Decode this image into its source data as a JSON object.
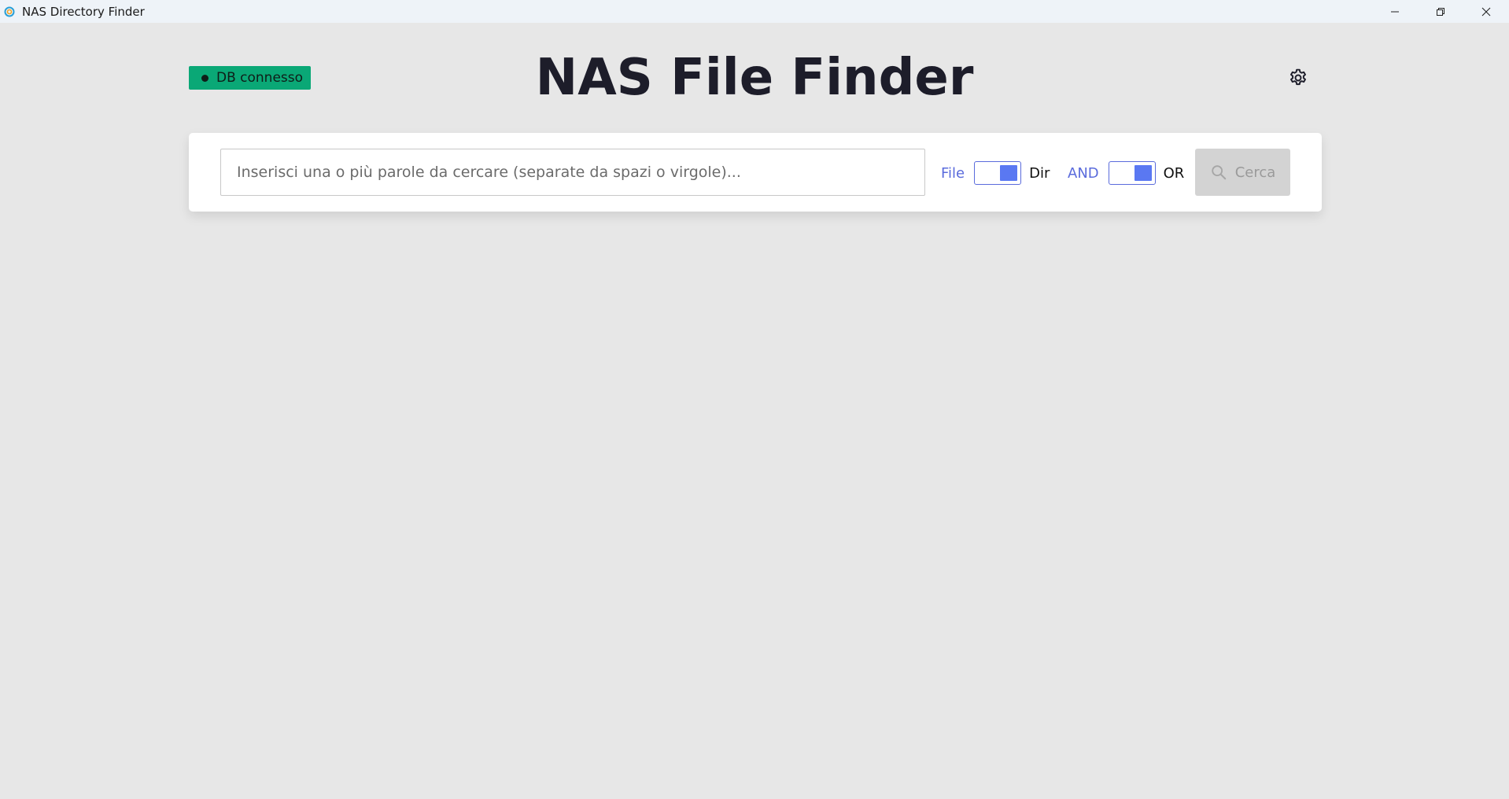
{
  "window": {
    "title": "NAS Directory Finder",
    "app_icon": "nas-app-icon",
    "controls": {
      "minimize": "minimize-icon",
      "restore": "restore-icon",
      "close": "close-icon"
    }
  },
  "header": {
    "status_label": "DB connesso",
    "status_color": "#0aa876",
    "title": "NAS File Finder",
    "settings_icon": "gear-icon"
  },
  "search": {
    "placeholder": "Inserisci una o più parole da cercare (separate da spazi o virgole)...",
    "value": "",
    "type_toggle": {
      "left_label": "File",
      "right_label": "Dir",
      "selected": "Dir"
    },
    "logic_toggle": {
      "left_label": "AND",
      "right_label": "OR",
      "selected": "OR"
    },
    "button_label": "Cerca",
    "button_enabled": false
  },
  "colors": {
    "accent": "#5a6bdc",
    "toggle_knob": "#5a78f2",
    "background": "#e7e7e7",
    "title_text": "#1d1d2a"
  }
}
